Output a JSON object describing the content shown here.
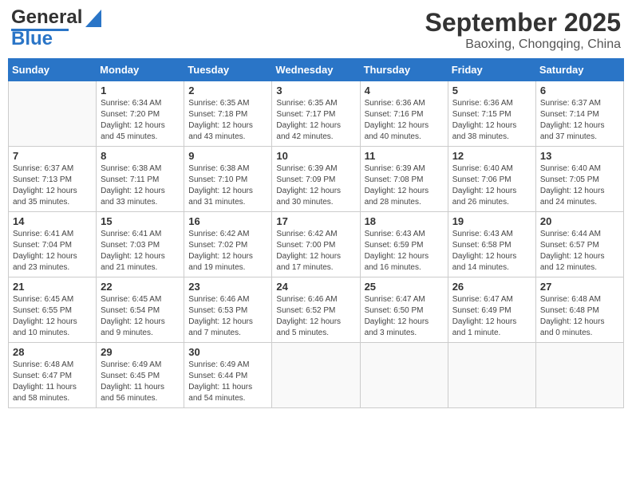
{
  "header": {
    "logo_line1": "General",
    "logo_line2": "Blue",
    "main_title": "September 2025",
    "subtitle": "Baoxing, Chongqing, China"
  },
  "days_of_week": [
    "Sunday",
    "Monday",
    "Tuesday",
    "Wednesday",
    "Thursday",
    "Friday",
    "Saturday"
  ],
  "weeks": [
    [
      {
        "day": "",
        "sunrise": "",
        "sunset": "",
        "daylight": ""
      },
      {
        "day": "1",
        "sunrise": "Sunrise: 6:34 AM",
        "sunset": "Sunset: 7:20 PM",
        "daylight": "Daylight: 12 hours and 45 minutes."
      },
      {
        "day": "2",
        "sunrise": "Sunrise: 6:35 AM",
        "sunset": "Sunset: 7:18 PM",
        "daylight": "Daylight: 12 hours and 43 minutes."
      },
      {
        "day": "3",
        "sunrise": "Sunrise: 6:35 AM",
        "sunset": "Sunset: 7:17 PM",
        "daylight": "Daylight: 12 hours and 42 minutes."
      },
      {
        "day": "4",
        "sunrise": "Sunrise: 6:36 AM",
        "sunset": "Sunset: 7:16 PM",
        "daylight": "Daylight: 12 hours and 40 minutes."
      },
      {
        "day": "5",
        "sunrise": "Sunrise: 6:36 AM",
        "sunset": "Sunset: 7:15 PM",
        "daylight": "Daylight: 12 hours and 38 minutes."
      },
      {
        "day": "6",
        "sunrise": "Sunrise: 6:37 AM",
        "sunset": "Sunset: 7:14 PM",
        "daylight": "Daylight: 12 hours and 37 minutes."
      }
    ],
    [
      {
        "day": "7",
        "sunrise": "Sunrise: 6:37 AM",
        "sunset": "Sunset: 7:13 PM",
        "daylight": "Daylight: 12 hours and 35 minutes."
      },
      {
        "day": "8",
        "sunrise": "Sunrise: 6:38 AM",
        "sunset": "Sunset: 7:11 PM",
        "daylight": "Daylight: 12 hours and 33 minutes."
      },
      {
        "day": "9",
        "sunrise": "Sunrise: 6:38 AM",
        "sunset": "Sunset: 7:10 PM",
        "daylight": "Daylight: 12 hours and 31 minutes."
      },
      {
        "day": "10",
        "sunrise": "Sunrise: 6:39 AM",
        "sunset": "Sunset: 7:09 PM",
        "daylight": "Daylight: 12 hours and 30 minutes."
      },
      {
        "day": "11",
        "sunrise": "Sunrise: 6:39 AM",
        "sunset": "Sunset: 7:08 PM",
        "daylight": "Daylight: 12 hours and 28 minutes."
      },
      {
        "day": "12",
        "sunrise": "Sunrise: 6:40 AM",
        "sunset": "Sunset: 7:06 PM",
        "daylight": "Daylight: 12 hours and 26 minutes."
      },
      {
        "day": "13",
        "sunrise": "Sunrise: 6:40 AM",
        "sunset": "Sunset: 7:05 PM",
        "daylight": "Daylight: 12 hours and 24 minutes."
      }
    ],
    [
      {
        "day": "14",
        "sunrise": "Sunrise: 6:41 AM",
        "sunset": "Sunset: 7:04 PM",
        "daylight": "Daylight: 12 hours and 23 minutes."
      },
      {
        "day": "15",
        "sunrise": "Sunrise: 6:41 AM",
        "sunset": "Sunset: 7:03 PM",
        "daylight": "Daylight: 12 hours and 21 minutes."
      },
      {
        "day": "16",
        "sunrise": "Sunrise: 6:42 AM",
        "sunset": "Sunset: 7:02 PM",
        "daylight": "Daylight: 12 hours and 19 minutes."
      },
      {
        "day": "17",
        "sunrise": "Sunrise: 6:42 AM",
        "sunset": "Sunset: 7:00 PM",
        "daylight": "Daylight: 12 hours and 17 minutes."
      },
      {
        "day": "18",
        "sunrise": "Sunrise: 6:43 AM",
        "sunset": "Sunset: 6:59 PM",
        "daylight": "Daylight: 12 hours and 16 minutes."
      },
      {
        "day": "19",
        "sunrise": "Sunrise: 6:43 AM",
        "sunset": "Sunset: 6:58 PM",
        "daylight": "Daylight: 12 hours and 14 minutes."
      },
      {
        "day": "20",
        "sunrise": "Sunrise: 6:44 AM",
        "sunset": "Sunset: 6:57 PM",
        "daylight": "Daylight: 12 hours and 12 minutes."
      }
    ],
    [
      {
        "day": "21",
        "sunrise": "Sunrise: 6:45 AM",
        "sunset": "Sunset: 6:55 PM",
        "daylight": "Daylight: 12 hours and 10 minutes."
      },
      {
        "day": "22",
        "sunrise": "Sunrise: 6:45 AM",
        "sunset": "Sunset: 6:54 PM",
        "daylight": "Daylight: 12 hours and 9 minutes."
      },
      {
        "day": "23",
        "sunrise": "Sunrise: 6:46 AM",
        "sunset": "Sunset: 6:53 PM",
        "daylight": "Daylight: 12 hours and 7 minutes."
      },
      {
        "day": "24",
        "sunrise": "Sunrise: 6:46 AM",
        "sunset": "Sunset: 6:52 PM",
        "daylight": "Daylight: 12 hours and 5 minutes."
      },
      {
        "day": "25",
        "sunrise": "Sunrise: 6:47 AM",
        "sunset": "Sunset: 6:50 PM",
        "daylight": "Daylight: 12 hours and 3 minutes."
      },
      {
        "day": "26",
        "sunrise": "Sunrise: 6:47 AM",
        "sunset": "Sunset: 6:49 PM",
        "daylight": "Daylight: 12 hours and 1 minute."
      },
      {
        "day": "27",
        "sunrise": "Sunrise: 6:48 AM",
        "sunset": "Sunset: 6:48 PM",
        "daylight": "Daylight: 12 hours and 0 minutes."
      }
    ],
    [
      {
        "day": "28",
        "sunrise": "Sunrise: 6:48 AM",
        "sunset": "Sunset: 6:47 PM",
        "daylight": "Daylight: 11 hours and 58 minutes."
      },
      {
        "day": "29",
        "sunrise": "Sunrise: 6:49 AM",
        "sunset": "Sunset: 6:45 PM",
        "daylight": "Daylight: 11 hours and 56 minutes."
      },
      {
        "day": "30",
        "sunrise": "Sunrise: 6:49 AM",
        "sunset": "Sunset: 6:44 PM",
        "daylight": "Daylight: 11 hours and 54 minutes."
      },
      {
        "day": "",
        "sunrise": "",
        "sunset": "",
        "daylight": ""
      },
      {
        "day": "",
        "sunrise": "",
        "sunset": "",
        "daylight": ""
      },
      {
        "day": "",
        "sunrise": "",
        "sunset": "",
        "daylight": ""
      },
      {
        "day": "",
        "sunrise": "",
        "sunset": "",
        "daylight": ""
      }
    ]
  ]
}
